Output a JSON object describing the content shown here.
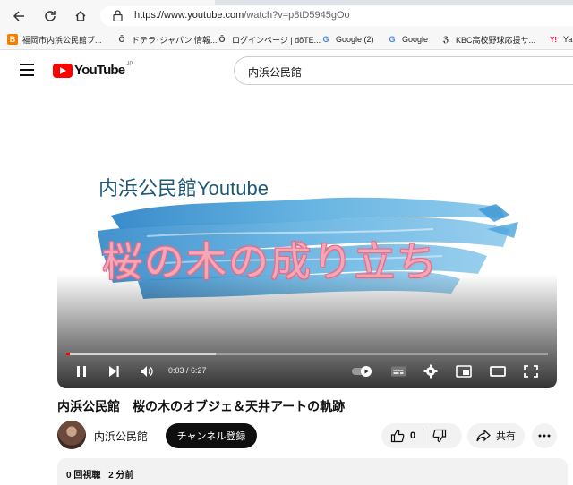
{
  "browser": {
    "url_host": "https://www.youtube.com",
    "url_path": "/watch?v=p8tD5945gOo",
    "bookmarks": [
      {
        "label": "福岡市内浜公民館ブ...",
        "icon": "B",
        "icon_name": "blogger-icon",
        "color": "#f57d00"
      },
      {
        "label": "ドテラ･ジャパン 情報...",
        "icon": "Ō",
        "icon_name": "doterra-icon",
        "color": "#444444"
      },
      {
        "label": "ログインページ | dōTE...",
        "icon": "Ō",
        "icon_name": "doterra-icon",
        "color": "#444444"
      },
      {
        "label": "Google (2)",
        "icon": "G",
        "icon_name": "google-icon",
        "color": "#4285f4"
      },
      {
        "label": "Google",
        "icon": "G",
        "icon_name": "google-icon",
        "color": "#4285f4"
      },
      {
        "label": "KBC高校野球応援サ...",
        "icon": "ℨ",
        "icon_name": "kbc-icon",
        "color": "#333333"
      },
      {
        "label": "Ya",
        "icon": "Y!",
        "icon_name": "yahoo-icon",
        "color": "#ff0033"
      }
    ]
  },
  "youtube": {
    "logo_text": "YouTube",
    "logo_region": "JP",
    "search_query": "内浜公民館"
  },
  "player": {
    "thumbnail_heading": "内浜公民館Youtube",
    "thumbnail_title": "桜の木の成り立ち",
    "time_display": "0:03 / 6:27",
    "played_fraction": 0.008,
    "buffered_fraction": 0.31
  },
  "video": {
    "title": "内浜公民館　桜の木のオブジェ＆天井アートの軌跡",
    "channel": "内浜公民館",
    "subscribe_label": "チャンネル登録",
    "likes": "0",
    "share_label": "共有",
    "views": "0 回視聴",
    "age": "2 分前"
  },
  "colors": {
    "youtube_red": "#ff0000",
    "brush_blue": "#3a96d2",
    "sakura_pink": "#f2a8b6"
  }
}
